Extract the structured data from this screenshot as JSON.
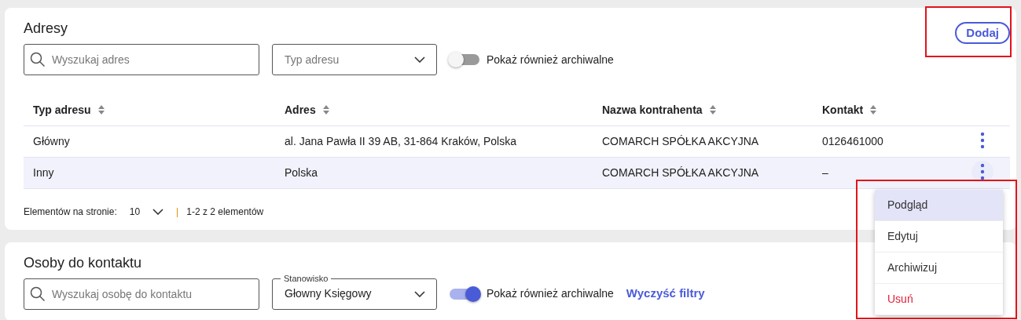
{
  "sections": [
    {
      "title": "Adresy",
      "add_button": {
        "label": "Dodaj",
        "highlighted": true
      },
      "search": {
        "placeholder": "Wyszukaj adres"
      },
      "filter": {
        "placeholder": "Typ adresu"
      },
      "archive_toggle": {
        "label": "Pokaż również archiwalne",
        "on": false
      },
      "table": {
        "columns": [
          "Typ adresu",
          "Adres",
          "Nazwa kontrahenta",
          "Kontakt"
        ],
        "rows": [
          {
            "cells": [
              "Główny",
              "al. Jana Pawła II 39 AB, 31-864 Kraków, Polska",
              "COMARCH SPÓŁKA AKCYJNA",
              "0126461000"
            ],
            "selected": false,
            "menu_open": false
          },
          {
            "cells": [
              "Inny",
              "Polska",
              "COMARCH SPÓŁKA AKCYJNA",
              "–"
            ],
            "selected": true,
            "menu_open": true
          }
        ]
      },
      "pagination": {
        "label": "Elementów na stronie:",
        "page_size": "10",
        "separator": "|",
        "summary": "1-2 z 2 elementów"
      }
    },
    {
      "title": "Osoby do kontaktu",
      "search": {
        "placeholder": "Wyszukaj osobę do kontaktu"
      },
      "filter": {
        "label": "Stanowisko",
        "value": "Głowny Księgowy"
      },
      "archive_toggle": {
        "label": "Pokaż również archiwalne",
        "on": true
      },
      "clear_filters": "Wyczyść filtry"
    }
  ],
  "row_menu": {
    "highlighted": true,
    "items": [
      {
        "label": "Podgląd",
        "kind": "normal",
        "selected": true
      },
      {
        "label": "Edytuj",
        "kind": "normal",
        "selected": false
      },
      {
        "label": "Archiwizuj",
        "kind": "normal",
        "selected": false
      },
      {
        "label": "Usuń",
        "kind": "danger",
        "selected": false
      }
    ]
  }
}
